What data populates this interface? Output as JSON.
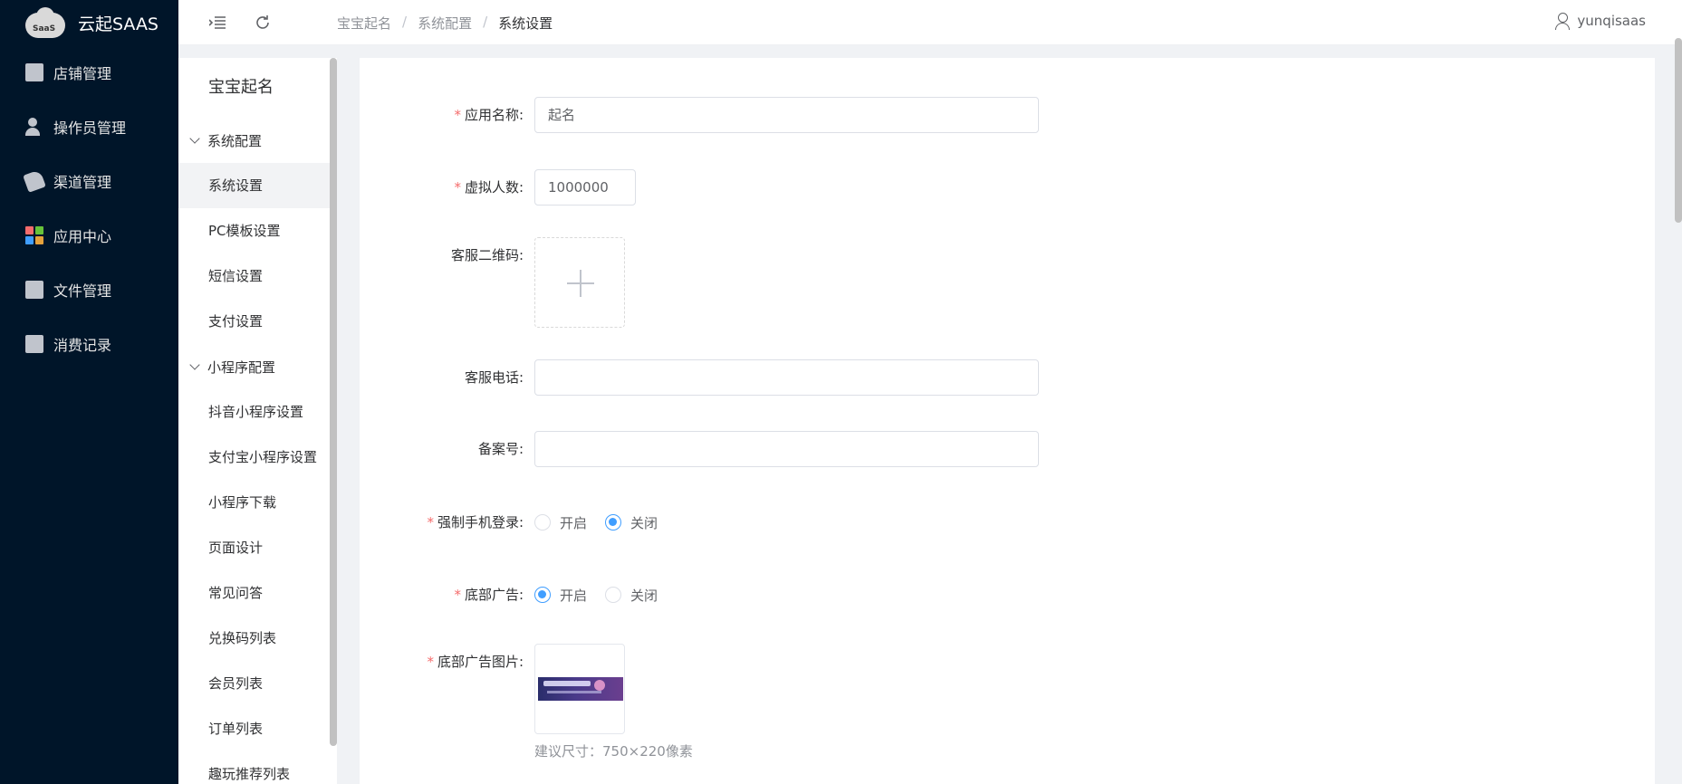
{
  "brand": {
    "logo_text": "SaaS",
    "name": "云起SAAS"
  },
  "nav": {
    "items": [
      {
        "label": "店铺管理",
        "icon": "store-icon"
      },
      {
        "label": "操作员管理",
        "icon": "operator-icon"
      },
      {
        "label": "渠道管理",
        "icon": "channel-icon"
      },
      {
        "label": "应用中心",
        "icon": "apps-icon"
      },
      {
        "label": "文件管理",
        "icon": "file-icon"
      },
      {
        "label": "消费记录",
        "icon": "record-icon"
      }
    ]
  },
  "header": {
    "breadcrumb": [
      "宝宝起名",
      "系统配置",
      "系统设置"
    ],
    "separator": "/",
    "user": "yunqisaas"
  },
  "subnav": {
    "title": "宝宝起名",
    "group1": "系统配置",
    "group1_items": [
      "系统设置",
      "PC模板设置",
      "短信设置",
      "支付设置"
    ],
    "group2": "小程序配置",
    "group2_items": [
      "抖音小程序设置",
      "支付宝小程序设置",
      "小程序下载",
      "页面设计",
      "常见问答",
      "兑换码列表",
      "会员列表",
      "订单列表",
      "趣玩推荐列表"
    ]
  },
  "form": {
    "app_name": {
      "label": "应用名称:",
      "value": "起名"
    },
    "virtual_count": {
      "label": "虚拟人数:",
      "value": "1000000"
    },
    "qrcode": {
      "label": "客服二维码:"
    },
    "phone": {
      "label": "客服电话:",
      "value": ""
    },
    "icp": {
      "label": "备案号:",
      "value": ""
    },
    "force_login": {
      "label": "强制手机登录:",
      "options": [
        "开启",
        "关闭"
      ],
      "selected": "关闭"
    },
    "bottom_ad": {
      "label": "底部广告:",
      "options": [
        "开启",
        "关闭"
      ],
      "selected": "开启"
    },
    "bottom_ad_img": {
      "label": "底部广告图片:",
      "hint": "建议尺寸：750×220像素"
    },
    "required_mark": "*"
  },
  "colors": {
    "nav_bg": "#001529",
    "primary": "#409eff",
    "required": "#f56c6c"
  }
}
